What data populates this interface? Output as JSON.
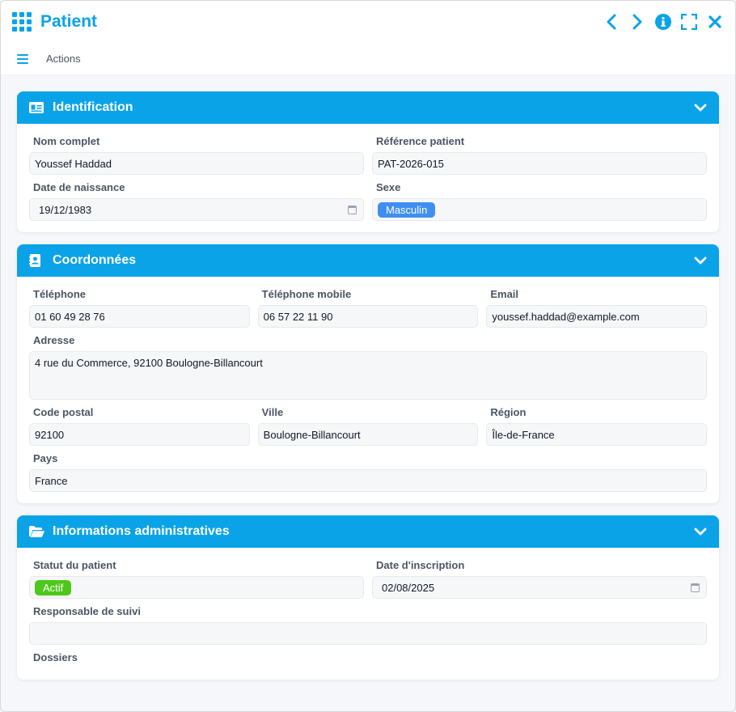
{
  "window": {
    "title": "Patient"
  },
  "toolbar": {
    "actions_label": "Actions"
  },
  "sections": {
    "identification": {
      "title": "Identification",
      "fields": {
        "nom_complet": {
          "label": "Nom complet",
          "value": "Youssef Haddad"
        },
        "reference": {
          "label": "Référence patient",
          "value": "PAT-2026-015"
        },
        "naissance": {
          "label": "Date de naissance",
          "value": "19/12/1983"
        },
        "sexe": {
          "label": "Sexe",
          "value": "Masculin"
        }
      }
    },
    "coordonnees": {
      "title": "Coordonnées",
      "fields": {
        "telephone": {
          "label": "Téléphone",
          "value": "01 60 49 28 76"
        },
        "mobile": {
          "label": "Téléphone mobile",
          "value": "06 57 22 11 90"
        },
        "email": {
          "label": "Email",
          "value": "youssef.haddad@example.com"
        },
        "adresse": {
          "label": "Adresse",
          "value": "4 rue du Commerce, 92100 Boulogne-Billancourt"
        },
        "code_postal": {
          "label": "Code postal",
          "value": "92100"
        },
        "ville": {
          "label": "Ville",
          "value": "Boulogne-Billancourt"
        },
        "region": {
          "label": "Région",
          "value": "Île-de-France"
        },
        "pays": {
          "label": "Pays",
          "value": "France"
        }
      }
    },
    "administratif": {
      "title": "Informations administratives",
      "fields": {
        "statut": {
          "label": "Statut du patient",
          "value": "Actif"
        },
        "inscription": {
          "label": "Date d'inscription",
          "value": "02/08/2025"
        },
        "responsable": {
          "label": "Responsable de suivi",
          "value": ""
        },
        "dossiers": {
          "label": "Dossiers"
        }
      }
    }
  },
  "colors": {
    "accent": "#0aa3e8",
    "badge_blue": "#3f8ff0",
    "badge_green": "#4dc81b"
  },
  "icons": {
    "app": "grid-icon",
    "prev": "chevron-left-icon",
    "next": "chevron-right-icon",
    "info": "info-icon",
    "fullscreen": "fullscreen-icon",
    "close": "close-icon",
    "menu": "hamburger-icon",
    "identification": "id-card-icon",
    "coordonnees": "contact-book-icon",
    "administratif": "folder-open-icon",
    "collapse": "chevron-down-icon",
    "date": "calendar-icon"
  }
}
